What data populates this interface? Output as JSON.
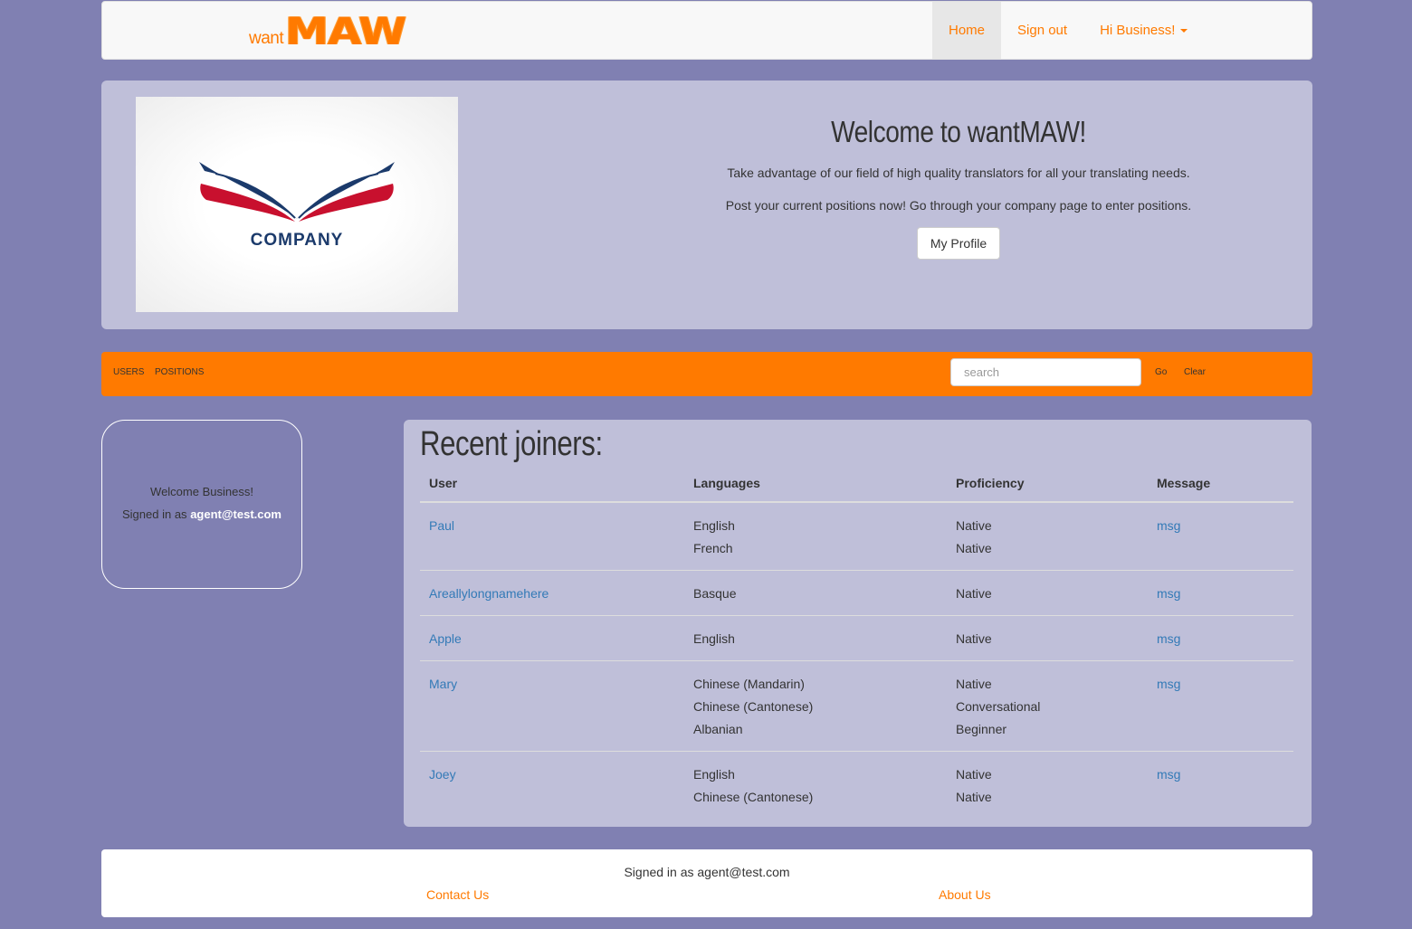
{
  "brand": {
    "small": "want",
    "big": "MAW"
  },
  "nav": {
    "home": "Home",
    "signout": "Sign out",
    "user_menu": "Hi Business!"
  },
  "jumbotron": {
    "logo_text": "COMPANY",
    "title": "Welcome to wantMAW!",
    "line1": "Take advantage of our field of high quality translators for all your translating needs.",
    "line2": "Post your current positions now! Go through your company page to enter positions.",
    "profile_button": "My Profile"
  },
  "toolbar": {
    "users": "USERS",
    "positions": "POSITIONS",
    "search_placeholder": "search",
    "go": "Go",
    "clear": "Clear"
  },
  "sidebar": {
    "welcome": "Welcome Business!",
    "signed_in_prefix": "Signed in as",
    "email": "agent@test.com"
  },
  "recent": {
    "heading": "Recent joiners:",
    "columns": [
      "User",
      "Languages",
      "Proficiency",
      "Message"
    ],
    "rows": [
      {
        "user": "Paul",
        "languages": [
          "English",
          "French"
        ],
        "proficiency": [
          "Native",
          "Native"
        ],
        "msg": "msg"
      },
      {
        "user": "Areallylongnamehere",
        "languages": [
          "Basque"
        ],
        "proficiency": [
          "Native"
        ],
        "msg": "msg"
      },
      {
        "user": "Apple",
        "languages": [
          "English"
        ],
        "proficiency": [
          "Native"
        ],
        "msg": "msg"
      },
      {
        "user": "Mary",
        "languages": [
          "Chinese (Mandarin)",
          "Chinese (Cantonese)",
          "Albanian"
        ],
        "proficiency": [
          "Native",
          "Conversational",
          "Beginner"
        ],
        "msg": "msg"
      },
      {
        "user": "Joey",
        "languages": [
          "English",
          "Chinese (Cantonese)"
        ],
        "proficiency": [
          "Native",
          "Native"
        ],
        "msg": "msg"
      }
    ]
  },
  "footer": {
    "signed": "Signed in as agent@test.com",
    "contact": "Contact Us",
    "about": "About Us"
  },
  "colors": {
    "background": "#8080b2",
    "accent": "#ff7a00",
    "panel": "#bfbfd9",
    "link": "#337ab7"
  }
}
